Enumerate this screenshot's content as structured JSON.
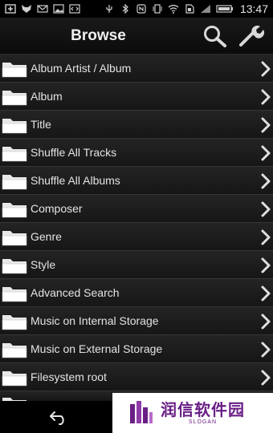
{
  "status_bar": {
    "time": "13:47",
    "left_icons": [
      "plus-box-icon",
      "fox-icon",
      "envelope-icon",
      "image-icon",
      "code-icon"
    ],
    "right_icons": [
      "usb-icon",
      "bluetooth-icon",
      "nfc-icon",
      "vibrate-icon",
      "wifi-icon",
      "sim-icon",
      "signal-icon",
      "battery-icon"
    ]
  },
  "header": {
    "title": "Browse",
    "search_icon": "search-icon",
    "settings_icon": "wrench-icon"
  },
  "list": {
    "items": [
      {
        "label": "Album Artist / Album"
      },
      {
        "label": "Album"
      },
      {
        "label": "Title"
      },
      {
        "label": "Shuffle All Tracks"
      },
      {
        "label": "Shuffle All Albums"
      },
      {
        "label": "Composer"
      },
      {
        "label": "Genre"
      },
      {
        "label": "Style"
      },
      {
        "label": "Advanced Search"
      },
      {
        "label": "Music on Internal Storage"
      },
      {
        "label": "Music on External Storage"
      },
      {
        "label": "Filesystem root"
      }
    ]
  },
  "navigation": {
    "back_icon": "back-arrow-icon"
  },
  "watermark": {
    "text": "润信软件园",
    "subtext": "SLOGAN",
    "color": "#6a1f86"
  }
}
